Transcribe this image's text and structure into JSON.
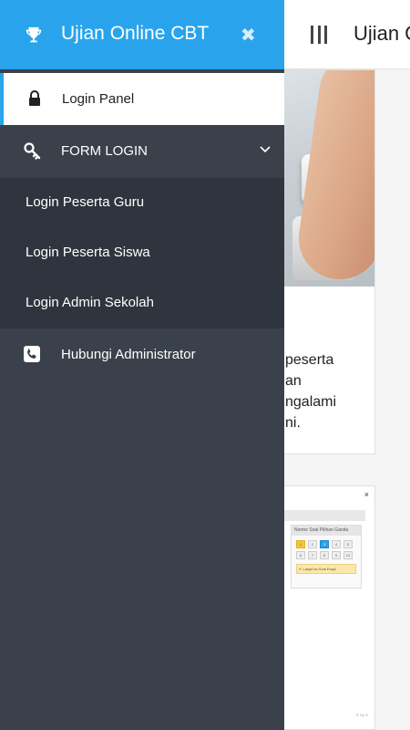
{
  "drawer": {
    "app_title": "Ujian Online CBT",
    "close_symbol": "✖",
    "items": [
      {
        "label": "Login Panel",
        "icon": "lock-icon",
        "active": true
      },
      {
        "label": "FORM LOGIN",
        "icon": "key-icon",
        "expanded": true
      },
      {
        "label": "Hubungi Administrator",
        "icon": "phone-icon"
      }
    ],
    "submenu": [
      {
        "label": "Login Peserta Guru"
      },
      {
        "label": "Login Peserta Siswa"
      },
      {
        "label": "Login Admin Sekolah"
      }
    ],
    "colors": {
      "header": "#29a4ec",
      "drawer_bg": "#3a414b",
      "submenu_bg": "#2f353e"
    }
  },
  "main": {
    "title": "Ujian O",
    "card1_lines": [
      "peserta",
      "an",
      "ngalami",
      "ni."
    ],
    "card2": {
      "close_symbol": "×",
      "panel_title": "Nomor Soal Pilihan Ganda",
      "numbers": [
        "1",
        "2",
        "3",
        "4",
        "5",
        "6",
        "7",
        "8",
        "9",
        "10"
      ],
      "note": "✔ Lanjut ke Soal Esay!",
      "footer": "© Sp S"
    }
  }
}
